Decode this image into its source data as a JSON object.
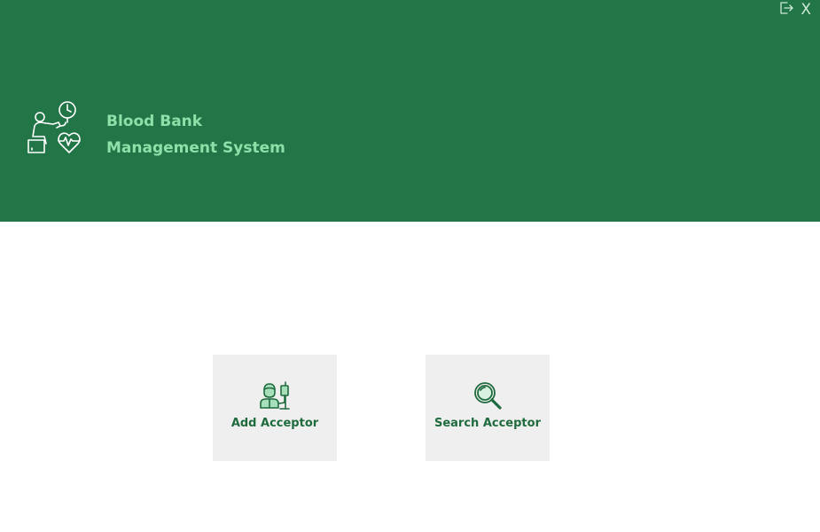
{
  "header": {
    "title_line1": "Blood Bank",
    "title_line2": "Management System",
    "logo_icon": "blood-donor-heartbeat-icon",
    "background_color": "#227547",
    "title_color": "#8ee0a8"
  },
  "window_controls": {
    "logout_icon": "logout-icon",
    "close_label": "X"
  },
  "actions": {
    "add": {
      "label": "Add Acceptor",
      "icon": "acceptor-iv-drip-icon"
    },
    "search": {
      "label": "Search Acceptor",
      "icon": "magnifier-icon"
    },
    "tile_background": "#efefef",
    "accent_color": "#1f6b3e"
  }
}
